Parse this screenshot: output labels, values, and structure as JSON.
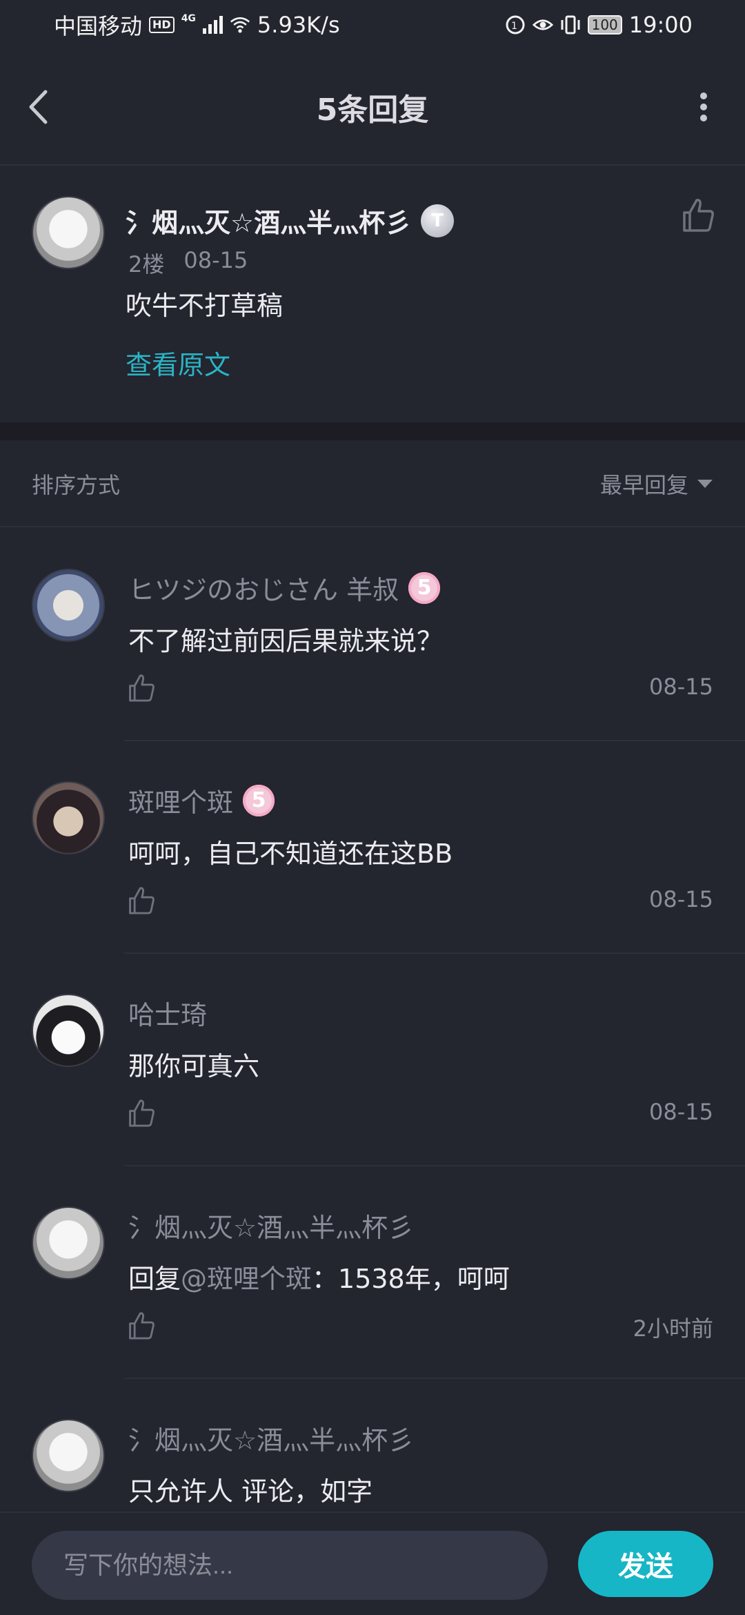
{
  "status_bar": {
    "carrier": "中国移动",
    "hd": "HD",
    "network": "4G",
    "speed": "5.93K/s",
    "battery": "100",
    "time": "19:00"
  },
  "header": {
    "title": "5条回复"
  },
  "original": {
    "user": "氵烟灬灭☆酒灬半灬杯彡",
    "badge": "T",
    "floor": "2楼",
    "date": "08-15",
    "content": "吹牛不打草稿",
    "view_original": "查看原文"
  },
  "sort": {
    "label": "排序方式",
    "value": "最早回复"
  },
  "replies": [
    {
      "user": "ヒツジのおじさん 羊叔",
      "level": "5",
      "text": "不了解过前因后果就来说？",
      "time": "08-15"
    },
    {
      "user": "斑哩个斑",
      "level": "5",
      "text": "呵呵，自己不知道还在这BB",
      "time": "08-15"
    },
    {
      "user": "哈士琦",
      "text": "那你可真六",
      "time": "08-15"
    },
    {
      "user": "氵烟灬灭☆酒灬半灬杯彡",
      "reply_prefix": "回复",
      "mention": "@斑哩个斑",
      "text": "：1538年，呵呵",
      "time": "2小时前"
    },
    {
      "user": "氵烟灬灭☆酒灬半灬杯彡",
      "text": "只允许人 评论，如字"
    }
  ],
  "input": {
    "placeholder": "写下你的想法..."
  },
  "send_label": "发送",
  "colors": {
    "background": "#23252f",
    "accent": "#16b6c6",
    "link": "#2bb4c4",
    "muted_text": "#8b8d98"
  }
}
